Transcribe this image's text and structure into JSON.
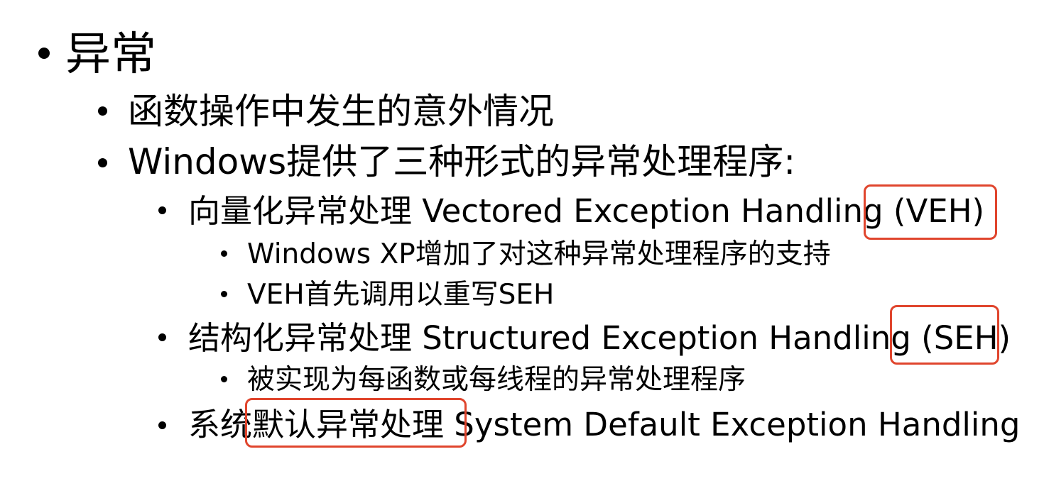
{
  "slide": {
    "accent_color": "#e0452d",
    "items": [
      {
        "level": 1,
        "text": "异常"
      },
      {
        "level": 2,
        "text": "函数操作中发生的意外情况"
      },
      {
        "level": 2,
        "text": "Windows提供了三种形式的异常处理程序:"
      },
      {
        "level": 3,
        "text": "向量化异常处理 Vectored Exception Handling (VEH)"
      },
      {
        "level": 4,
        "text": "Windows XP增加了对这种异常处理程序的支持"
      },
      {
        "level": 4,
        "text": "VEH首先调用以重写SEH"
      },
      {
        "level": 3,
        "text": "结构化异常处理 Structured Exception Handling (SEH)"
      },
      {
        "level": 4,
        "text": "被实现为每函数或每线程的异常处理程序"
      },
      {
        "level": 3,
        "text": "系统默认异常处理 System Default Exception Handling"
      }
    ]
  }
}
